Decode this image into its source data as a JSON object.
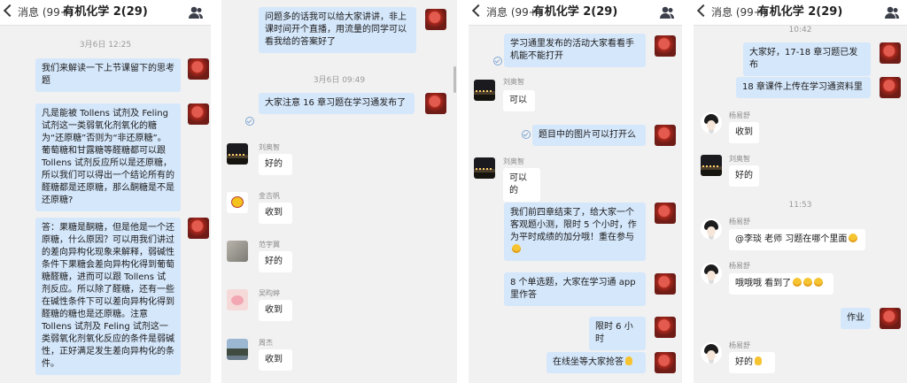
{
  "panels": [
    {
      "nav": {
        "back": "消息 (99+)",
        "title": "有机化学 2(29)",
        "right_icon": "group-members-icon"
      },
      "timestamp": "3月6日 12:25",
      "messages": [
        {
          "text": "我们来解读一下上节课留下的思考题"
        },
        {
          "text": "凡是能被 Tollens 试剂及 Feling 试剂这一类弱氧化剂氧化的糖为“还原糖”否则为“非还原糖”。葡萄糖和甘露糖等醛糖都可以跟 Tollens 试剂反应所以是还原糖，所以我们可以得出一个结论所有的醛糖都是还原糖，那么酮糖是不是还原糖?"
        },
        {
          "text": "答：果糖是酮糖，但是他是一个还原糖，什么原因？可以用我们讲过的差向异构化现象来解释，弱碱性条件下果糖会差向异构化得到葡萄糖醛糖，进而可以跟 Tollens 试剂反应。所以除了醛糖，还有一些在碱性条件下可以差向异构化得到醛糖的糖也是还原糖。注意 Tollens 试剂及 Feling 试剂这一类弱氧化剂氧化反应的条件是弱碱性，正好满足发生差向异构化的条件。"
        }
      ]
    },
    {
      "timestamp": "3月6日 09:49",
      "messages": [
        {
          "text": "问题多的话我可以给大家讲讲，非上课时间开个直播，用流量的同学可以看我给的答案好了"
        },
        {
          "text": "大家注意 16 章习题在学习通发布了"
        },
        {
          "name": "刘奥智",
          "text": "好的"
        },
        {
          "name": "金吉帆",
          "text": "收到"
        },
        {
          "name": "范宇翼",
          "text": "好的"
        },
        {
          "name": "吴昀婷",
          "text": "收到"
        },
        {
          "name": "周杰",
          "text": "收到"
        }
      ]
    },
    {
      "nav": {
        "back": "消息 (99+)",
        "title": "有机化学 2(29)",
        "right_icon": "group-members-icon"
      },
      "messages": [
        {
          "text": "学习通里发布的活动大家看看手机能不能打开"
        },
        {
          "name": "刘奥智",
          "text": "可以"
        },
        {
          "text": "题目中的图片可以打开么"
        },
        {
          "name": "刘奥智",
          "text": "可以的"
        },
        {
          "text": "我们前四章结束了，给大家一个客观题小测，限时 5 个小时，作为平时成绩的加分哦！重在参与"
        },
        {
          "text": "8 个单选题，大家在学习通 app 里作答"
        },
        {
          "text": "限时 6 小时"
        },
        {
          "text": "在线坐等大家抢答"
        }
      ]
    },
    {
      "nav": {
        "back": "消息 (99+)",
        "title": "有机化学 2(29)",
        "right_icon": "group-members-icon"
      },
      "timestamp_1": "10:42",
      "timestamp_2": "11:53",
      "messages": [
        {
          "text": "大家好，17-18 章习题已发布"
        },
        {
          "text": "18 章课件上传在学习通资料里"
        },
        {
          "name": "杨易舒",
          "text": "收到"
        },
        {
          "name": "刘奥智",
          "text": "好的"
        },
        {
          "name": "杨易舒",
          "text": "@李琰 老师 习题在哪个里面"
        },
        {
          "name": "杨易舒",
          "text": "哦哦哦 看到了"
        },
        {
          "text": "作业"
        },
        {
          "name": "杨易舒",
          "text": "好的"
        }
      ]
    }
  ],
  "colors": {
    "sent_bubble": "#d5e7fb",
    "received_bubble": "#ffffff",
    "chat_bg": "#f1f1f1"
  }
}
